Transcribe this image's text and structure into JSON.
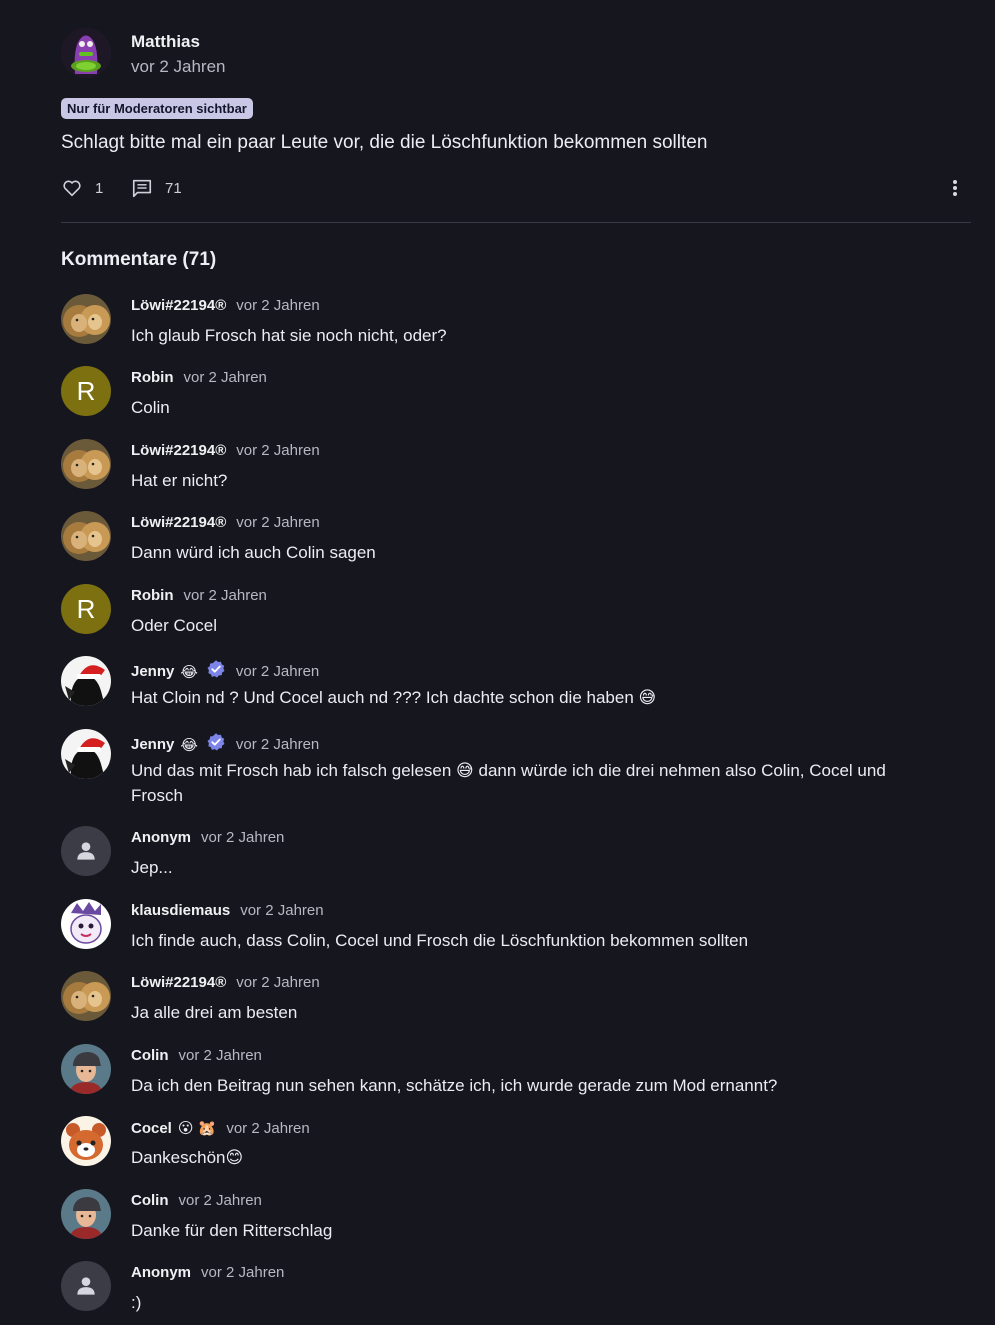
{
  "post": {
    "author": "Matthias",
    "time": "vor 2 Jahren",
    "badge": "Nur für Moderatoren sichtbar",
    "text": "Schlagt bitte mal ein paar Leute vor, die die Löschfunktion bekommen sollten",
    "likes": "1",
    "comments": "71",
    "avatar_icon": "purple-tentacle-icon"
  },
  "comments_heading": "Kommentare (71)",
  "colors": {
    "background": "#16161e",
    "badge": "#c8c8e6",
    "letter_avatar": "#7d7010"
  },
  "comments": [
    {
      "name": "Löwi#22194®",
      "time": "vor 2 Jahren",
      "text": "Ich glaub Frosch hat sie noch nicht, oder?",
      "avatar": "lion-avatar"
    },
    {
      "name": "Robin",
      "time": "vor 2 Jahren",
      "text": "Colin",
      "avatar": "letter",
      "letter": "R"
    },
    {
      "name": "Löwi#22194®",
      "time": "vor 2 Jahren",
      "text": "Hat er nicht?",
      "avatar": "lion-avatar"
    },
    {
      "name": "Löwi#22194®",
      "time": "vor 2 Jahren",
      "text": "Dann würd ich auch Colin sagen",
      "avatar": "lion-avatar"
    },
    {
      "name": "Robin",
      "time": "vor 2 Jahren",
      "text": "Oder Cocel",
      "avatar": "letter",
      "letter": "R"
    },
    {
      "name": "Jenny",
      "emoji": "😂",
      "verified": true,
      "time": "vor 2 Jahren",
      "text": "Hat Cloin nd ? Und Cocel auch nd ??? Ich dachte schon die haben 😅",
      "avatar": "santa-hat-avatar"
    },
    {
      "name": "Jenny",
      "emoji": "😂",
      "verified": true,
      "time": "vor 2 Jahren",
      "text": "Und das mit Frosch hab ich falsch gelesen 😅 dann würde ich die drei nehmen also Colin, Cocel und Frosch",
      "avatar": "santa-hat-avatar"
    },
    {
      "name": "Anonym",
      "time": "vor 2 Jahren",
      "text": "Jep...",
      "avatar": "anon"
    },
    {
      "name": "klausdiemaus",
      "time": "vor 2 Jahren",
      "text": "Ich finde auch, dass Colin, Cocel und Frosch die Löschfunktion bekommen sollten",
      "avatar": "cartoon-avatar"
    },
    {
      "name": "Löwi#22194®",
      "time": "vor 2 Jahren",
      "text": "Ja alle drei am besten",
      "avatar": "lion-avatar"
    },
    {
      "name": "Colin",
      "time": "vor 2 Jahren",
      "text": "Da ich den Beitrag nun sehen kann, schätze ich, ich wurde gerade zum Mod ernannt?",
      "avatar": "cap-boy-avatar"
    },
    {
      "name": "Cocel",
      "emoji": "😮 🐹",
      "time": "vor 2 Jahren",
      "text": "Dankeschön😊",
      "avatar": "red-panda-avatar"
    },
    {
      "name": "Colin",
      "time": "vor 2 Jahren",
      "text": "Danke für den Ritterschlag",
      "avatar": "cap-boy-avatar"
    },
    {
      "name": "Anonym",
      "time": "vor 2 Jahren",
      "text": ":)",
      "avatar": "anon"
    }
  ]
}
